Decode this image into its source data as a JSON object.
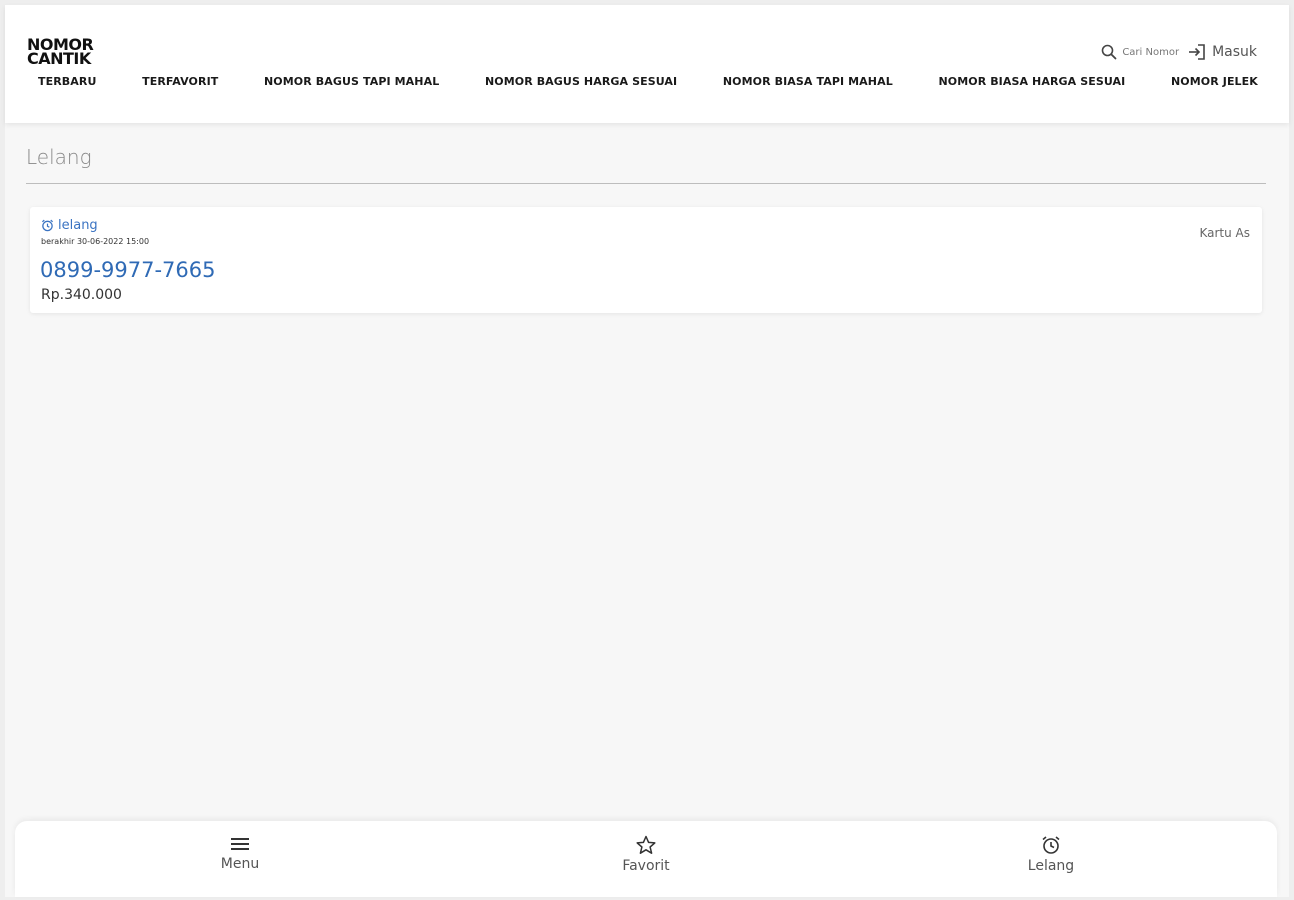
{
  "logo": {
    "line1": "NOMOR",
    "line2": "CANTIK"
  },
  "nav": [
    {
      "label": "TERBARU"
    },
    {
      "label": "TERFAVORIT"
    },
    {
      "label": "NOMOR BAGUS TAPI MAHAL"
    },
    {
      "label": "NOMOR BAGUS HARGA SESUAI"
    },
    {
      "label": "NOMOR BIASA TAPI MAHAL"
    },
    {
      "label": "NOMOR BIASA HARGA SESUAI"
    },
    {
      "label": "NOMOR JELEK"
    }
  ],
  "header_actions": {
    "search_label": "Cari Nomor",
    "search_icon": "search-icon",
    "login_label": "Masuk",
    "login_icon": "login-icon"
  },
  "page": {
    "title": "Lelang"
  },
  "listing": {
    "badge": "lelang",
    "badge_icon": "alarm-clock-icon",
    "ends": "berakhir 30-06-2022 15:00",
    "number": "0899-9977-7665",
    "price": "Rp.340.000",
    "operator": "Kartu As"
  },
  "bottom_nav": [
    {
      "label": "Menu",
      "icon": "menu-icon"
    },
    {
      "label": "Favorit",
      "icon": "star-icon"
    },
    {
      "label": "Lelang",
      "icon": "alarm-clock-icon"
    }
  ],
  "colors": {
    "accent": "#2f6ab5",
    "background": "#f7f7f7",
    "surface": "#ffffff"
  }
}
